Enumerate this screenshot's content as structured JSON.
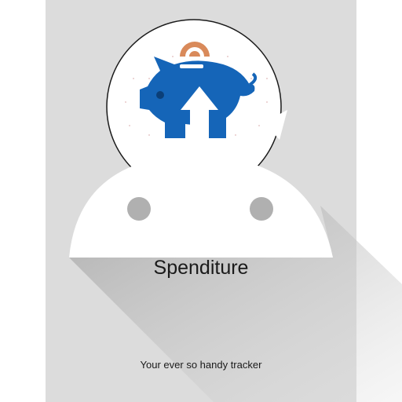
{
  "app": {
    "title": "Spenditure",
    "tagline": "Your ever so handy tracker"
  },
  "colors": {
    "screen_background": "#dcdcdc",
    "piggy_blue": "#1565b8",
    "coin_orange": "#d98a5a",
    "android_head": "#ffffff",
    "android_eye": "#b0b0b0"
  },
  "icons": {
    "logo": "piggy-bank-arrow-up-icon",
    "mascot": "android-head-icon"
  }
}
